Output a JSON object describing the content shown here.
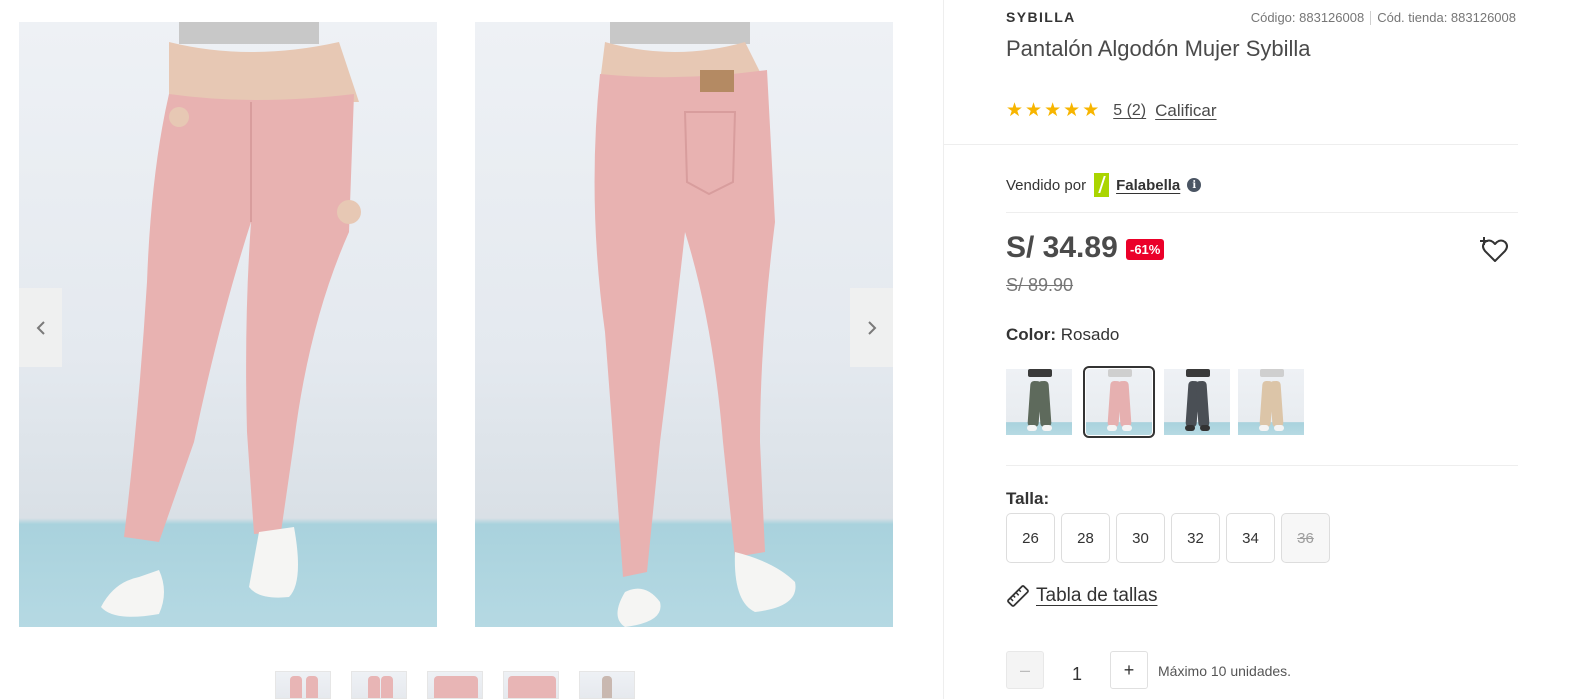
{
  "gallery": {
    "prev_icon": "chevron-left-icon",
    "next_icon": "chevron-right-icon",
    "thumbnails": 5
  },
  "product": {
    "brand": "SYBILLA",
    "code_label": "Código: 883126008",
    "store_code_label": "Cód. tienda: 883126008",
    "title": "Pantalón Algodón Mujer Sybilla",
    "rating": {
      "stars": 5,
      "count_text": "5 (2)",
      "rate_link": "Calificar"
    },
    "seller": {
      "label": "Vendido por",
      "name": "Falabella",
      "logo_color": "#aad500"
    },
    "price": "S/ 34.89",
    "discount": "-61%",
    "old_price": "S/ 89.90",
    "color": {
      "label": "Color:",
      "value": "Rosado",
      "swatches": [
        {
          "name": "olive",
          "leg": "#5e6a5c"
        },
        {
          "name": "rosado",
          "leg": "#e6b0b0",
          "selected": true
        },
        {
          "name": "charcoal",
          "leg": "#4a4f55"
        },
        {
          "name": "beige",
          "leg": "#dcc5a8"
        }
      ]
    },
    "size": {
      "label": "Talla:",
      "options": [
        "26",
        "28",
        "30",
        "32",
        "34",
        "36"
      ],
      "disabled": [
        "36"
      ]
    },
    "size_chart_link": "Tabla de tallas",
    "quantity": {
      "minus": "–",
      "value": "1",
      "plus": "+",
      "max_text": "Máximo 10 unidades."
    }
  },
  "colors": {
    "discount_badge": "#eb0029",
    "star": "#f7b500"
  }
}
